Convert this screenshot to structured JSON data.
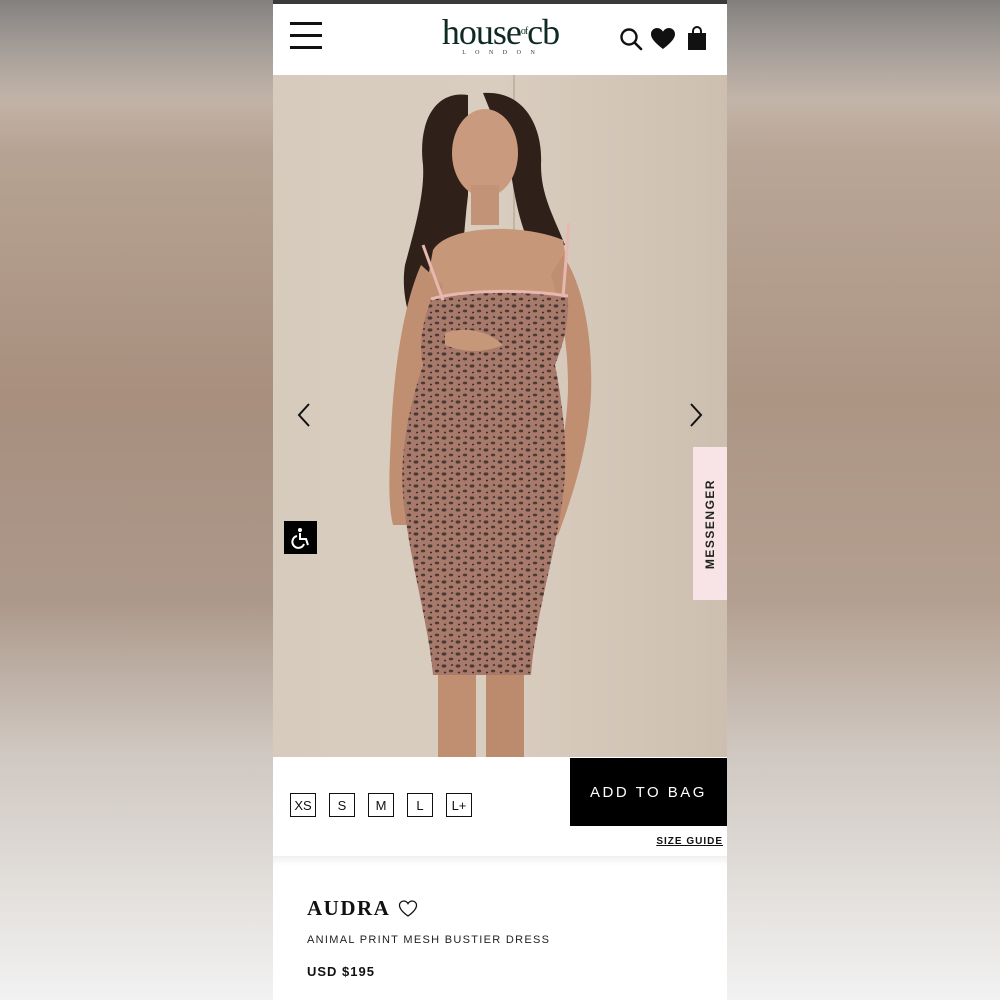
{
  "header": {
    "logo_text": "house of cb",
    "logo_sub": "LONDON",
    "icons": [
      "menu-icon",
      "search-icon",
      "heart-icon",
      "bag-icon"
    ]
  },
  "hero": {
    "prev_icon": "chevron-left-icon",
    "next_icon": "chevron-right-icon",
    "accessibility_icon": "wheelchair-icon",
    "messenger_label": "MESSENGER"
  },
  "sizes": [
    "XS",
    "S",
    "M",
    "L",
    "L+"
  ],
  "actions": {
    "add_to_bag": "ADD TO BAG",
    "size_guide": "SIZE GUIDE"
  },
  "product": {
    "name": "AUDRA",
    "description": "ANIMAL PRINT MESH BUSTIER DRESS",
    "price": "USD $195"
  },
  "colors": {
    "brand": "#0e2a25",
    "messenger_bg": "#f8e4e6",
    "button_bg": "#000000"
  }
}
